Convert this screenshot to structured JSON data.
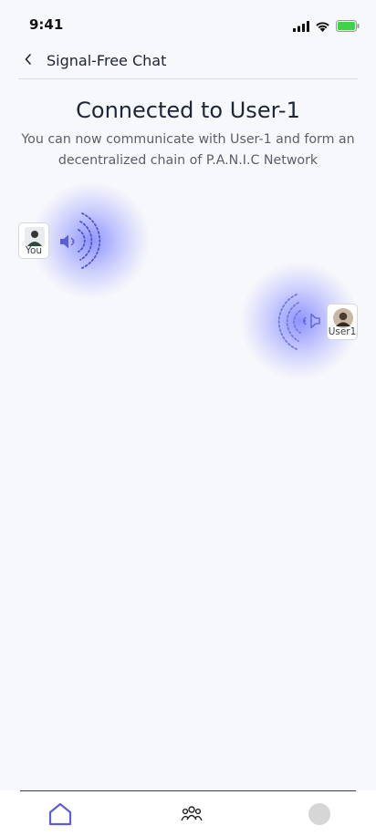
{
  "status_bar": {
    "time": "9:41",
    "icons": [
      "signal-icon",
      "wifi-icon",
      "battery-icon"
    ]
  },
  "header": {
    "title": "Signal-Free Chat",
    "back_icon": "chevron-left-icon"
  },
  "connection": {
    "title": "Connected to User-1",
    "description": "You can now communicate with User-1 and form an decentralized chain of P.A.N.I.C Network"
  },
  "peers": {
    "you": {
      "label": "You"
    },
    "remote": {
      "label": "User1"
    }
  },
  "bottom_nav": {
    "items": [
      {
        "icon": "home-icon",
        "active": true
      },
      {
        "icon": "people-icon",
        "active": false
      },
      {
        "icon": "profile-icon",
        "active": false
      }
    ]
  },
  "colors": {
    "accent": "#5b5fd6",
    "glow": "#6b6fff",
    "background": "#f7f8fb"
  }
}
